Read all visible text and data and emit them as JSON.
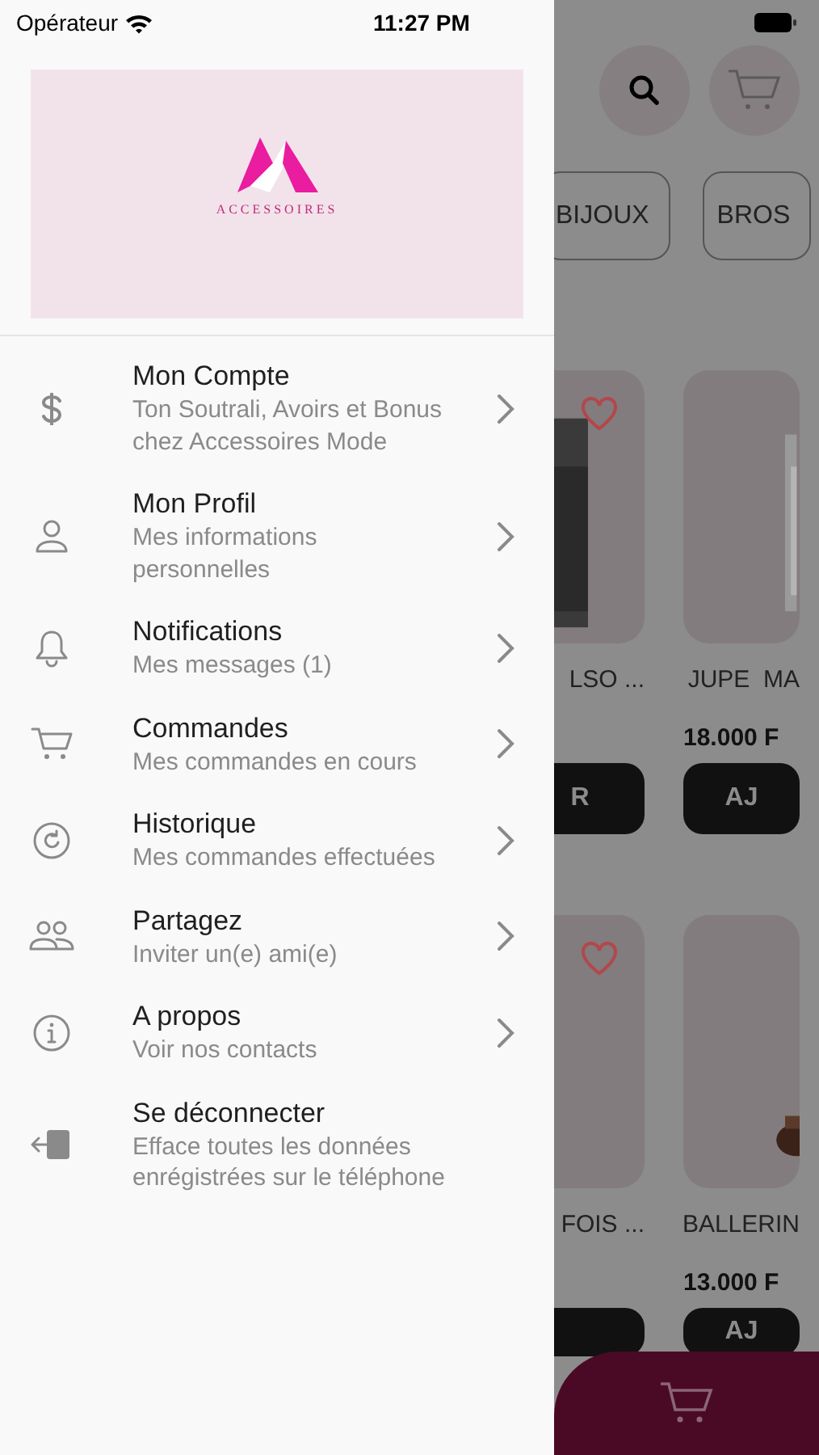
{
  "status_bar": {
    "carrier": "Opérateur",
    "time": "11:27 PM"
  },
  "drawer": {
    "logo_text": "ACCESSOIRES",
    "items": [
      {
        "title": "Mon Compte",
        "subtitle": "Ton Soutrali, Avoirs et Bonus chez Accessoires Mode",
        "chevron": true
      },
      {
        "title": "Mon Profil",
        "subtitle": "Mes informations personnelles",
        "chevron": true
      },
      {
        "title": "Notifications",
        "subtitle": "Mes messages (1)",
        "chevron": true
      },
      {
        "title": "Commandes",
        "subtitle": "Mes commandes en cours",
        "chevron": true
      },
      {
        "title": "Historique",
        "subtitle": "Mes commandes effectuées",
        "chevron": true
      },
      {
        "title": "Partagez",
        "subtitle": "Inviter un(e) ami(e)",
        "chevron": true
      },
      {
        "title": "A propos",
        "subtitle": "Voir nos contacts",
        "chevron": true
      },
      {
        "title": "Se déconnecter",
        "subtitle": "Efface toutes les données enrégistrées sur le téléphone",
        "chevron": false
      }
    ]
  },
  "background": {
    "chips": [
      "BIJOUX",
      "BROS"
    ],
    "products": [
      {
        "name": "LSO ...",
        "button": "R",
        "favorite": true
      },
      {
        "name": "JUPE  MA",
        "price": "18.000 F",
        "button": "AJ",
        "favorite": false
      },
      {
        "name": "FOIS ...",
        "favorite": true
      },
      {
        "name": "BALLERIN",
        "price": "13.000 F",
        "button": "AJ",
        "favorite": false
      }
    ]
  }
}
